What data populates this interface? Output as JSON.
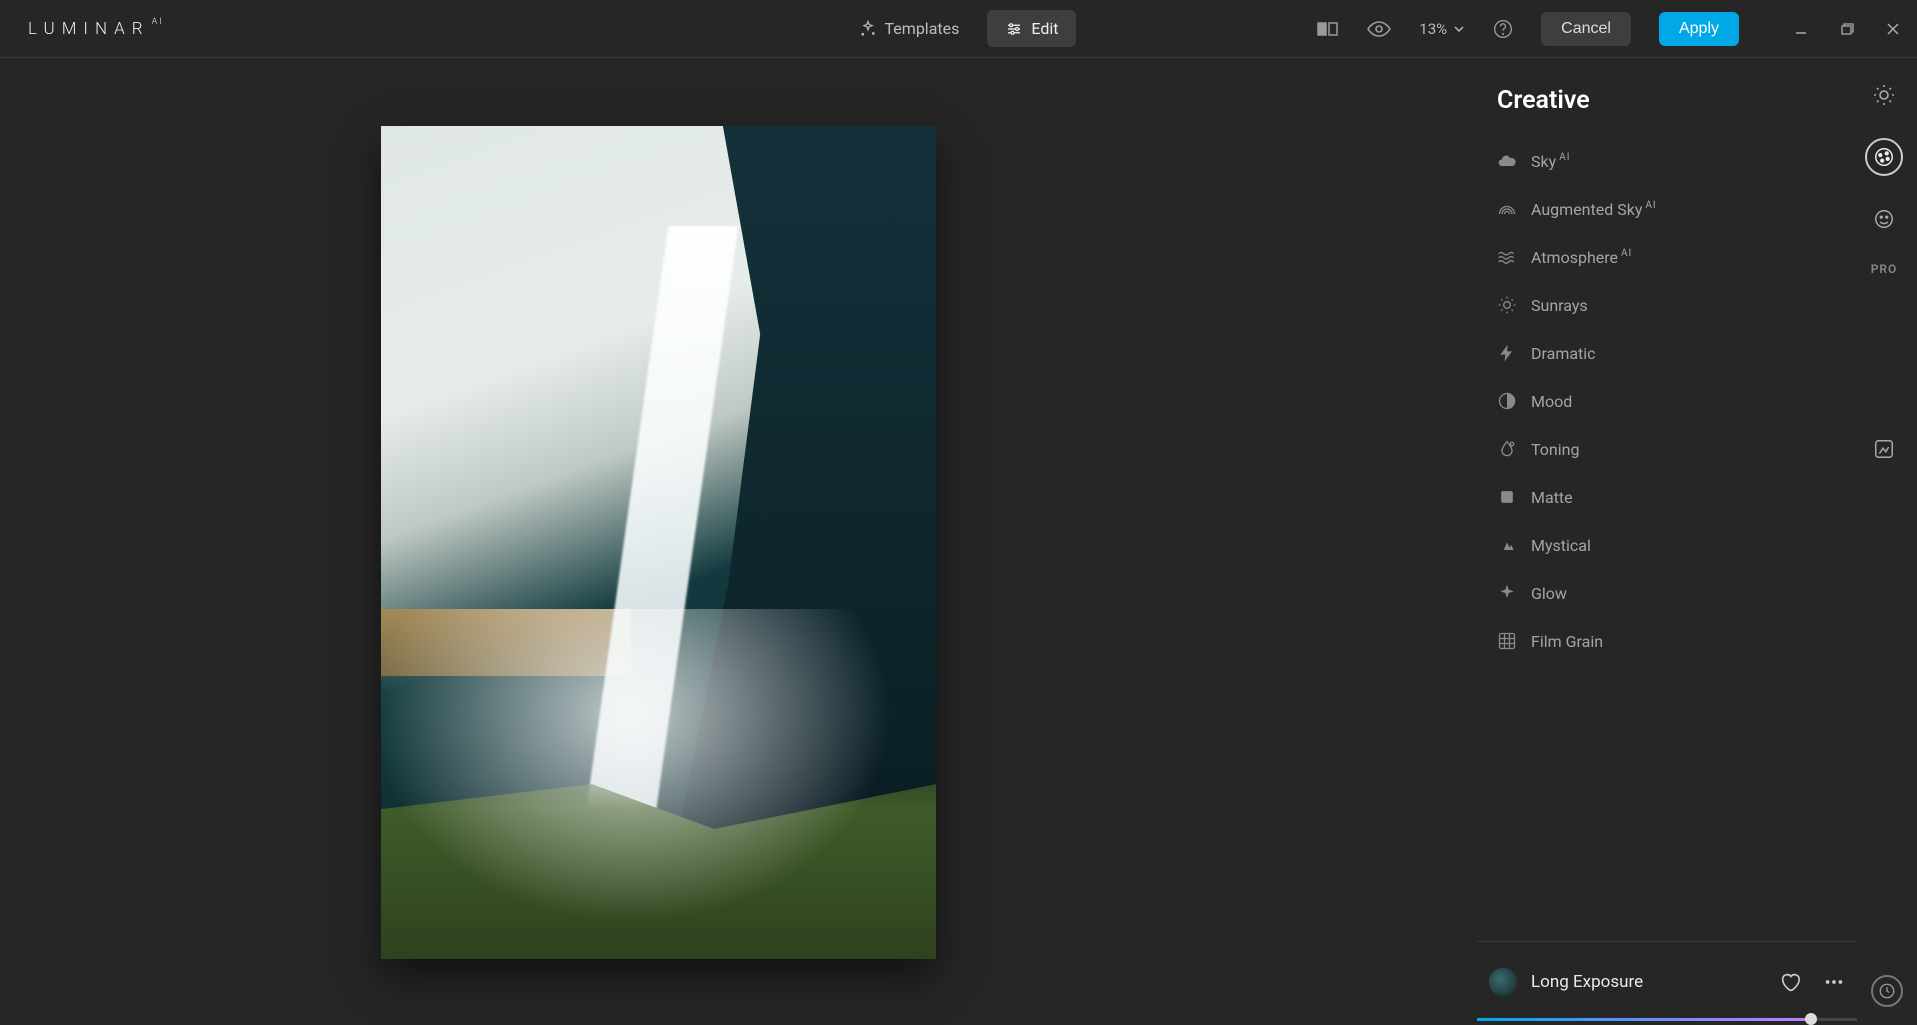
{
  "app": {
    "name": "LUMINAR",
    "suffix": "AI"
  },
  "tabs": {
    "templates": "Templates",
    "edit": "Edit"
  },
  "top": {
    "zoom": "13%",
    "cancel": "Cancel",
    "apply": "Apply"
  },
  "panel": {
    "title": "Creative",
    "tools": [
      {
        "label": "Sky",
        "ai": true
      },
      {
        "label": "Augmented Sky",
        "ai": true
      },
      {
        "label": "Atmosphere",
        "ai": true
      },
      {
        "label": "Sunrays",
        "ai": false
      },
      {
        "label": "Dramatic",
        "ai": false
      },
      {
        "label": "Mood",
        "ai": false
      },
      {
        "label": "Toning",
        "ai": false
      },
      {
        "label": "Matte",
        "ai": false
      },
      {
        "label": "Mystical",
        "ai": false
      },
      {
        "label": "Glow",
        "ai": false
      },
      {
        "label": "Film Grain",
        "ai": false
      }
    ],
    "ai_badge": "AI"
  },
  "side": {
    "pro": "PRO"
  },
  "preset": {
    "name": "Long Exposure"
  }
}
